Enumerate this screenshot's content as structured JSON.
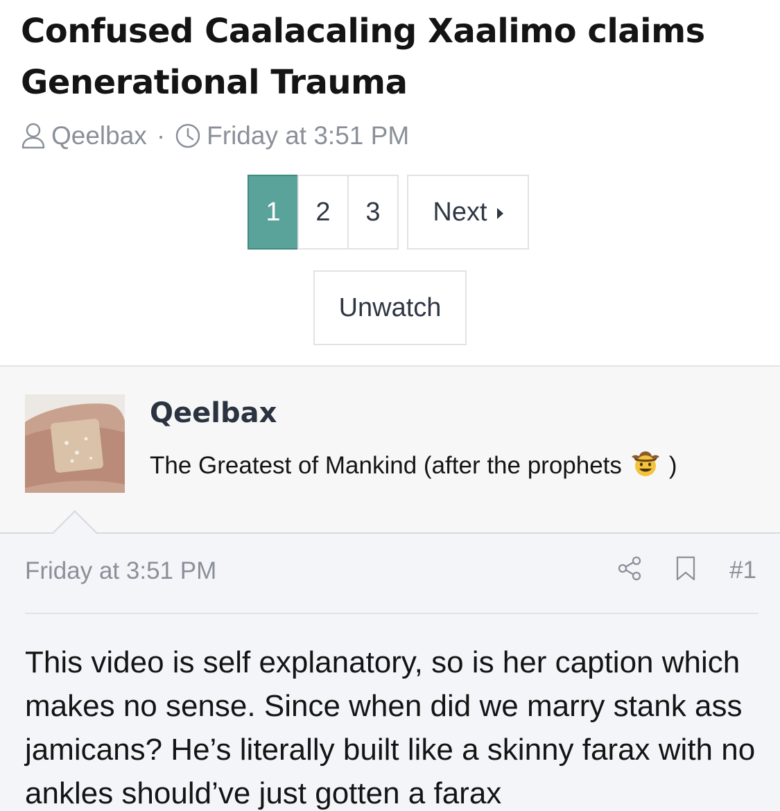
{
  "thread": {
    "title": "Confused Caalacaling Xaalimo claims Generational Trauma",
    "author": "Qeelbax",
    "separator": "·",
    "date": "Friday at 3:51 PM"
  },
  "pagination": {
    "pages": [
      "1",
      "2",
      "3"
    ],
    "current": "1",
    "next_label": "Next"
  },
  "watch_button": {
    "label": "Unwatch"
  },
  "post": {
    "username": "Qeelbax",
    "user_title": "The Greatest of Mankind (after the prophets",
    "user_title_close": ")",
    "date": "Friday at 3:51 PM",
    "number": "#1",
    "body": "This video is self explanatory, so is her caption which makes no sense. Since when did we marry stank ass jamicans? He’s literally built like a skinny farax with no ankles should’ve just gotten a farax"
  },
  "icons": {
    "author": "user-icon",
    "date": "clock-icon",
    "share": "share-icon",
    "bookmark": "bookmark-icon",
    "emoji": "cowboy-emoji-icon"
  },
  "colors": {
    "accent": "#5aa39a",
    "muted_text": "#8a8f99",
    "username": "#2b3340",
    "post_bg": "#f4f5f8"
  }
}
